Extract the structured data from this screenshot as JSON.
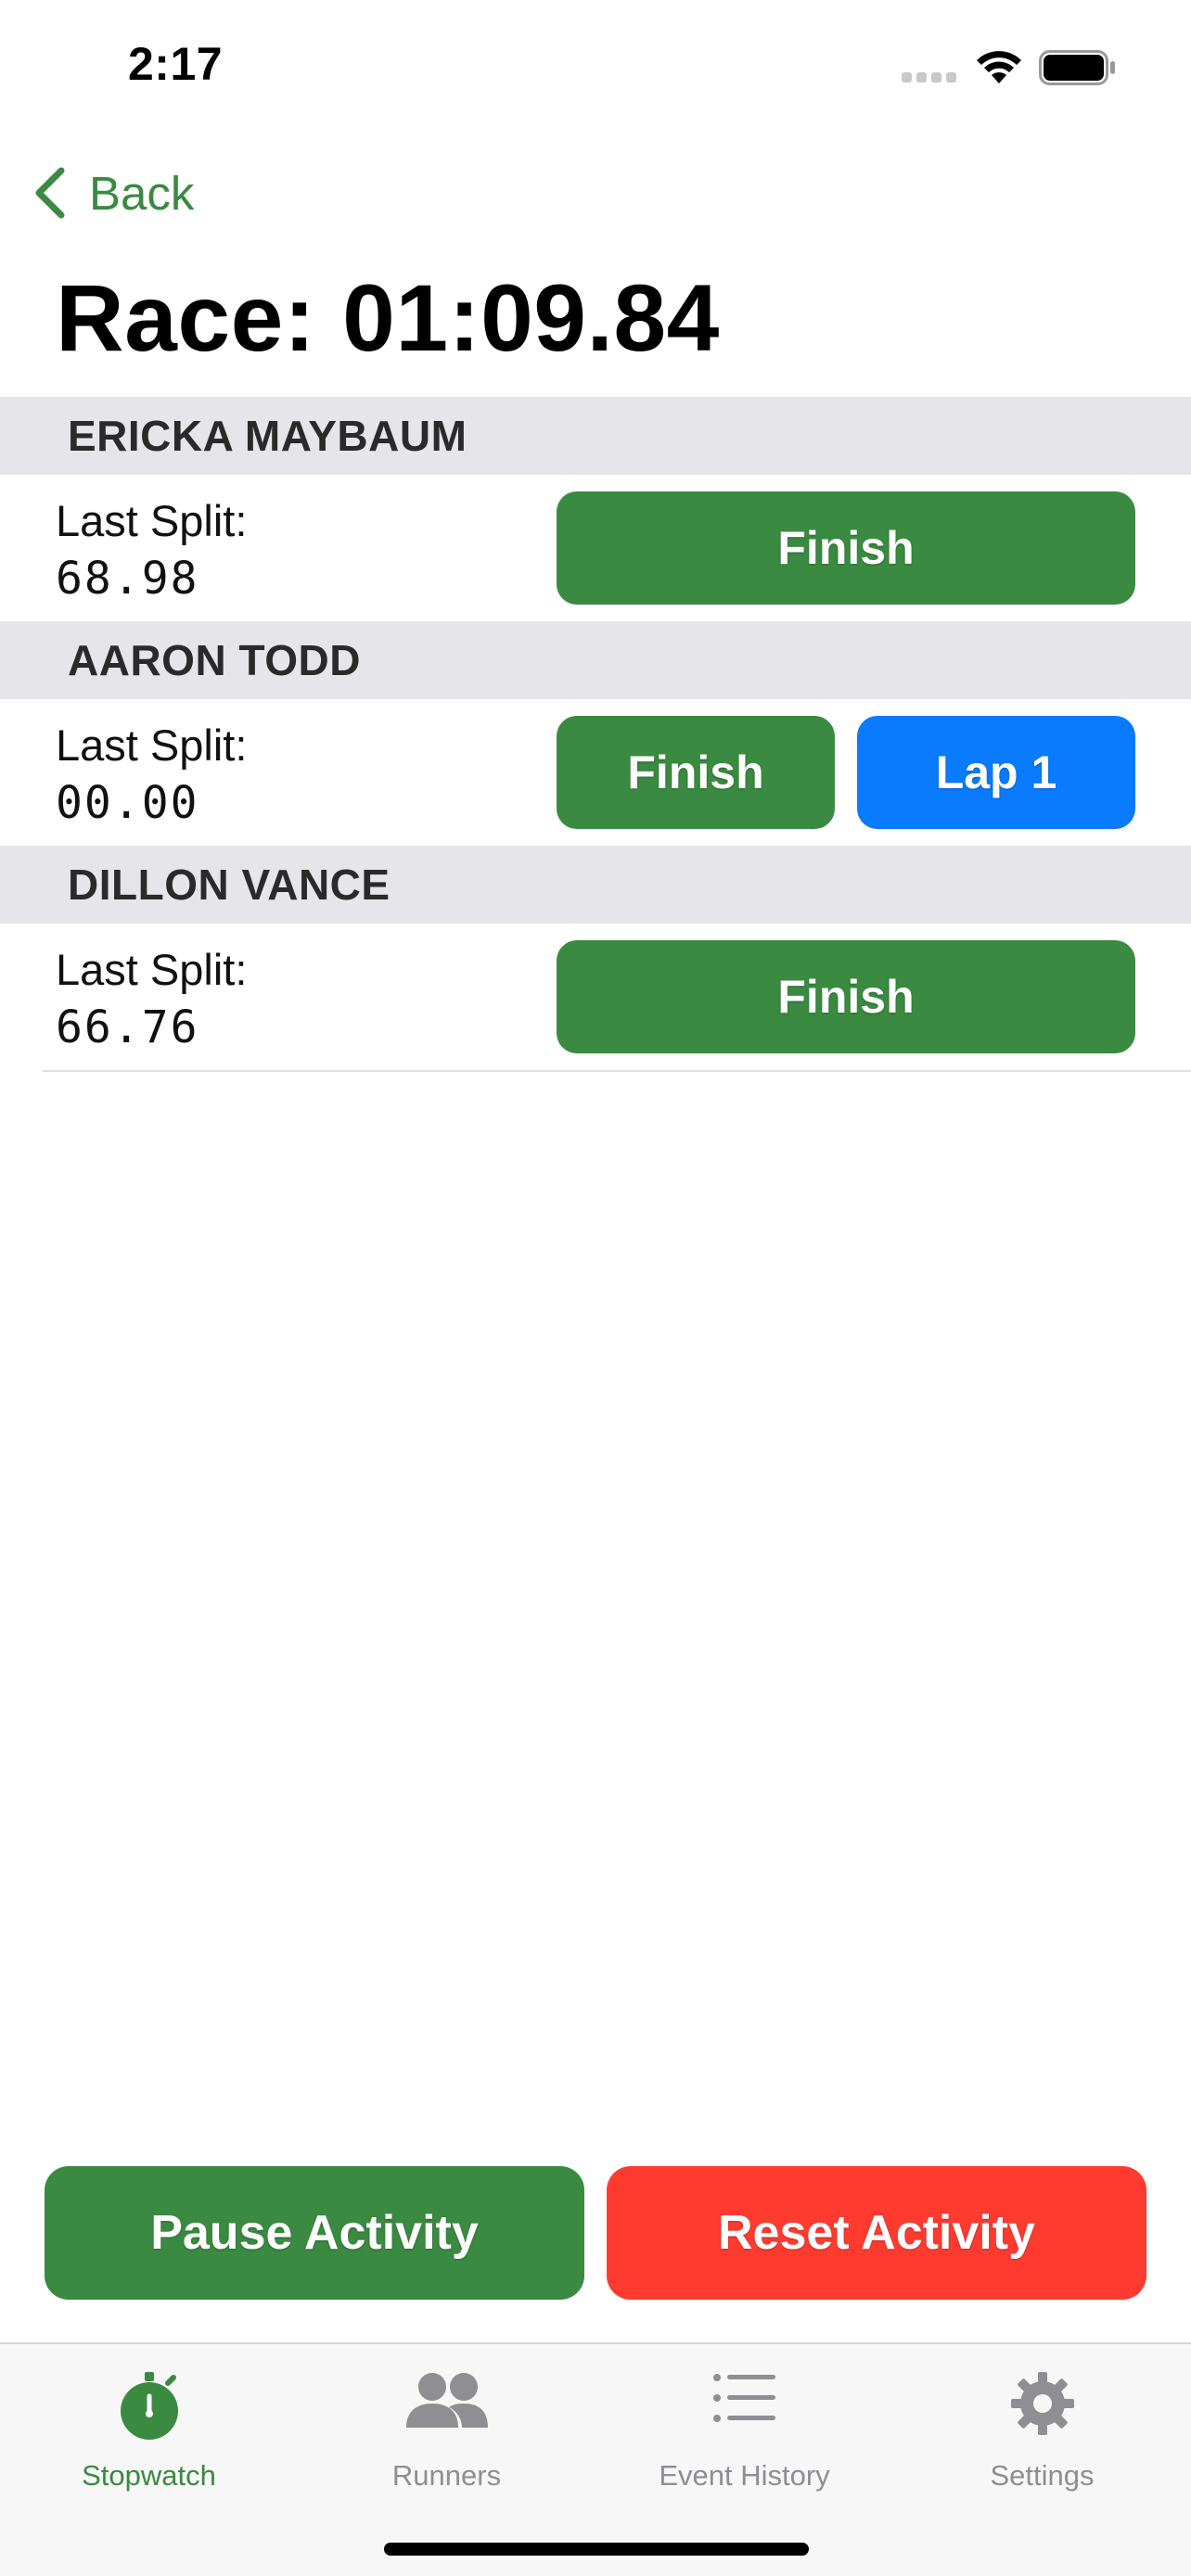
{
  "status_bar": {
    "time": "2:17",
    "icons": [
      "cellular-signal-icon",
      "wifi-icon",
      "battery-icon"
    ]
  },
  "nav": {
    "back_label": "Back"
  },
  "page": {
    "title": "Race: 01:09.84"
  },
  "runners": [
    {
      "name": "ERICKA MAYBAUM",
      "split_label": "Last Split:",
      "split_value": "68.98",
      "finish_label": "Finish"
    },
    {
      "name": "AARON TODD",
      "split_label": "Last Split:",
      "split_value": "00.00",
      "finish_label": "Finish",
      "lap_label": "Lap 1"
    },
    {
      "name": "DILLON VANCE",
      "split_label": "Last Split:",
      "split_value": "66.76",
      "finish_label": "Finish"
    }
  ],
  "actions": {
    "pause_label": "Pause Activity",
    "reset_label": "Reset Activity"
  },
  "tab_bar": {
    "tabs": [
      {
        "label": "Stopwatch",
        "icon": "stopwatch-icon",
        "active": true
      },
      {
        "label": "Runners",
        "icon": "people-icon",
        "active": false
      },
      {
        "label": "Event History",
        "icon": "list-icon",
        "active": false
      },
      {
        "label": "Settings",
        "icon": "gear-icon",
        "active": false
      }
    ]
  },
  "colors": {
    "accent_green": "#3a8a41",
    "lap_blue": "#0a7aff",
    "reset_red": "#ff3b30",
    "section_header_gray": "#e5e5ea",
    "inactive_tab_gray": "#8e8e93"
  }
}
